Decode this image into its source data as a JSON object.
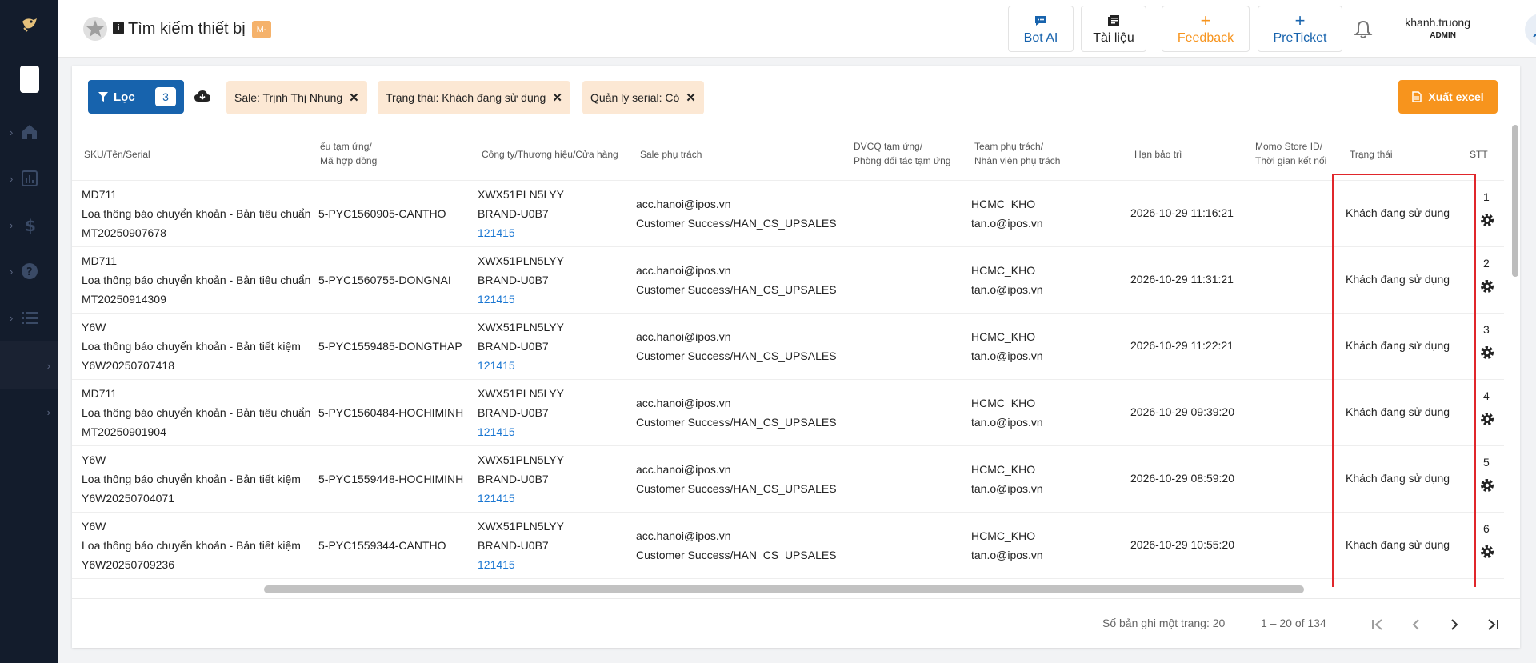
{
  "header": {
    "title": "Tìm kiếm thiết bị",
    "badge": "M-",
    "buttons": [
      {
        "label": "Bot AI",
        "icon": "chat-icon",
        "color": "#1763ad"
      },
      {
        "label": "Tài liệu",
        "icon": "document-icon",
        "color": "#222222"
      },
      {
        "label": "Feedback",
        "icon": "plus-icon",
        "color": "#f7941d"
      },
      {
        "label": "PreTicket",
        "icon": "plus-icon",
        "color": "#1763ad"
      }
    ],
    "user": {
      "name": "khanh.truong",
      "role": "ADMIN"
    }
  },
  "toolbar": {
    "filter_label": "Lọc",
    "filter_count": "3",
    "chips": [
      {
        "label": "Sale: Trịnh Thị Nhung"
      },
      {
        "label": "Trạng thái: Khách đang sử dụng"
      },
      {
        "label": "Quản lý serial: Có"
      }
    ],
    "export_label": "Xuất excel"
  },
  "table": {
    "columns": [
      {
        "l1": "SKU/Tên/Serial",
        "l2": ""
      },
      {
        "l1": "ếu tạm ứng/",
        "l2": "Mã hợp đồng"
      },
      {
        "l1": "Công ty/Thương hiệu/Cửa hàng",
        "l2": ""
      },
      {
        "l1": "Sale phụ trách",
        "l2": ""
      },
      {
        "l1": "ĐVCQ tạm ứng/",
        "l2": "Phòng đối tác tạm ứng"
      },
      {
        "l1": "Team phụ trách/",
        "l2": "Nhân viên phụ trách"
      },
      {
        "l1": "Hạn bảo trì",
        "l2": ""
      },
      {
        "l1": "Momo Store ID/",
        "l2": "Thời gian kết nối"
      },
      {
        "l1": "Trạng thái",
        "l2": ""
      },
      {
        "l1": "STT",
        "l2": ""
      }
    ],
    "rows": [
      {
        "sku": "MD711",
        "name": "Loa thông báo chuyển khoản - Bản tiêu chuẩn",
        "serial": "MT20250907678",
        "contract": "5-PYC1560905-CANTHO",
        "company": "XWX51PLN5LYY",
        "brand": "BRAND-U0B7",
        "store": "121415",
        "sale1": "acc.hanoi@ipos.vn",
        "sale2": "Customer Success/HAN_CS_UPSALES",
        "team": "HCMC_KHO",
        "staff": "tan.o@ipos.vn",
        "warranty": "2026-10-29 11:16:21",
        "status": "Khách đang sử dụng",
        "stt": "1"
      },
      {
        "sku": "MD711",
        "name": "Loa thông báo chuyển khoản - Bản tiêu chuẩn",
        "serial": "MT20250914309",
        "contract": "5-PYC1560755-DONGNAI",
        "company": "XWX51PLN5LYY",
        "brand": "BRAND-U0B7",
        "store": "121415",
        "sale1": "acc.hanoi@ipos.vn",
        "sale2": "Customer Success/HAN_CS_UPSALES",
        "team": "HCMC_KHO",
        "staff": "tan.o@ipos.vn",
        "warranty": "2026-10-29 11:31:21",
        "status": "Khách đang sử dụng",
        "stt": "2"
      },
      {
        "sku": "Y6W",
        "name": "Loa thông báo chuyển khoản - Bản tiết kiệm",
        "serial": "Y6W20250707418",
        "contract": "5-PYC1559485-DONGTHAP",
        "company": "XWX51PLN5LYY",
        "brand": "BRAND-U0B7",
        "store": "121415",
        "sale1": "acc.hanoi@ipos.vn",
        "sale2": "Customer Success/HAN_CS_UPSALES",
        "team": "HCMC_KHO",
        "staff": "tan.o@ipos.vn",
        "warranty": "2026-10-29 11:22:21",
        "status": "Khách đang sử dụng",
        "stt": "3"
      },
      {
        "sku": "MD711",
        "name": "Loa thông báo chuyển khoản - Bản tiêu chuẩn",
        "serial": "MT20250901904",
        "contract": "5-PYC1560484-HOCHIMINH",
        "company": "XWX51PLN5LYY",
        "brand": "BRAND-U0B7",
        "store": "121415",
        "sale1": "acc.hanoi@ipos.vn",
        "sale2": "Customer Success/HAN_CS_UPSALES",
        "team": "HCMC_KHO",
        "staff": "tan.o@ipos.vn",
        "warranty": "2026-10-29 09:39:20",
        "status": "Khách đang sử dụng",
        "stt": "4"
      },
      {
        "sku": "Y6W",
        "name": "Loa thông báo chuyển khoản - Bản tiết kiệm",
        "serial": "Y6W20250704071",
        "contract": "5-PYC1559448-HOCHIMINH",
        "company": "XWX51PLN5LYY",
        "brand": "BRAND-U0B7",
        "store": "121415",
        "sale1": "acc.hanoi@ipos.vn",
        "sale2": "Customer Success/HAN_CS_UPSALES",
        "team": "HCMC_KHO",
        "staff": "tan.o@ipos.vn",
        "warranty": "2026-10-29 08:59:20",
        "status": "Khách đang sử dụng",
        "stt": "5"
      },
      {
        "sku": "Y6W",
        "name": "Loa thông báo chuyển khoản - Bản tiết kiệm",
        "serial": "Y6W20250709236",
        "contract": "5-PYC1559344-CANTHO",
        "company": "XWX51PLN5LYY",
        "brand": "BRAND-U0B7",
        "store": "121415",
        "sale1": "acc.hanoi@ipos.vn",
        "sale2": "Customer Success/HAN_CS_UPSALES",
        "team": "HCMC_KHO",
        "staff": "tan.o@ipos.vn",
        "warranty": "2026-10-29 10:55:20",
        "status": "Khách đang sử dụng",
        "stt": "6"
      }
    ]
  },
  "pager": {
    "per_page_label": "Số bản ghi một trang: 20",
    "range_label": "1 – 20 of 134"
  },
  "colors": {
    "primary": "#1763ad",
    "accent": "#f7941d",
    "highlight": "#e0262b",
    "sidebar": "#131c2c"
  }
}
